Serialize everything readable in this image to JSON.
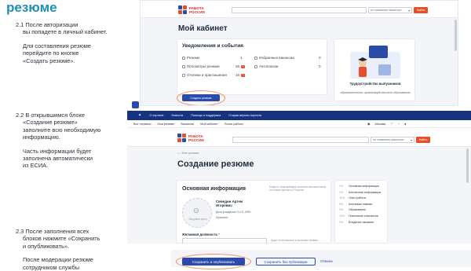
{
  "doc": {
    "title": "резюме",
    "steps": [
      {
        "num": "2.1",
        "line1": "После авторизации",
        "line2": "вы попадете в личный кабинет.",
        "extra": [
          "Для составления резюме",
          "перейдите по кнопке",
          "«Создать резюме»."
        ]
      },
      {
        "num": "2.2",
        "line1": "В открывшимся блоке",
        "line2": "«Создание резюме»",
        "line3": "заполните всю необходимую",
        "line4": "информацию.",
        "extra": [
          "Часть информации будет",
          "заполнена автоматически",
          "из ЕСИА."
        ]
      },
      {
        "num": "2.3",
        "line1": "После заполнения всех",
        "line2": "блоков нажмите «Сохранить",
        "line3": "и опубликовать».",
        "extra": [
          "После модерации резюме",
          "сотрудником службы"
        ]
      }
    ]
  },
  "screen1": {
    "logo": "РАБОТА РОССИИ",
    "search_select": "по названию вакансии",
    "find_button": "Найти",
    "heading": "Мой кабинет",
    "notif_title": "Уведомления и события",
    "notif_rows": [
      {
        "left_label": "Резюме",
        "left_count": "1",
        "right_label": "Избранные вакансии",
        "right_count": "0"
      },
      {
        "left_label": "Просмотры резюме",
        "left_count": "26",
        "right_label": "Автопоиски",
        "right_count": "0"
      },
      {
        "left_label": "Отклики и приглашения",
        "left_count": "16",
        "right_label": "",
        "right_count": ""
      }
    ],
    "create_button": "Создать резюме",
    "promo_title": "Трудоустройство выпускников",
    "promo_text": "образовательных организаций высшего образования"
  },
  "screen2": {
    "top_links": [
      "О портале",
      "Новости",
      "Помощь и поддержка",
      "Старая версия портала"
    ],
    "nav_links": [
      "Все сервисы",
      "Мои резюме",
      "Вакансии",
      "Мой кабинет",
      "Поиск работы"
    ],
    "location": "Москва",
    "logo": "РАБОТА РОССИИ",
    "search_select": "по названию вакансии",
    "find_button": "Найти",
    "breadcrumb": "Мое резюме",
    "heading": "Создание резюме",
    "basic_title": "Основная информация",
    "basic_note": "Раздел с информацией заполнен автоматически на основе данных из Госуслуг",
    "person_name": "Семедин Артем Игоревич",
    "birth": "Дата рождения 01.01.1990",
    "gender": "Мужчина",
    "upload_photo": "Загрузить фото",
    "desired_label": "Желаемая должность",
    "desired_hint": "Будет отображаться в заголовке резюме",
    "sidebar": [
      {
        "pct": "2%",
        "label": "Основная информация"
      },
      {
        "pct": "2%",
        "label": "Контактная информация"
      },
      {
        "pct": "10%",
        "label": "Опыт работы"
      },
      {
        "pct": "5%",
        "label": "Ключевые навыки"
      },
      {
        "pct": "5%",
        "label": "Образование"
      },
      {
        "pct": "15%",
        "label": "Пожелания к вакансии"
      },
      {
        "pct": "5%",
        "label": "Владение языками"
      }
    ]
  },
  "screen3": {
    "save_publish": "Сохранить и опубликовать",
    "save_draft": "Сохранить без публикации",
    "cancel": "Отмена"
  }
}
